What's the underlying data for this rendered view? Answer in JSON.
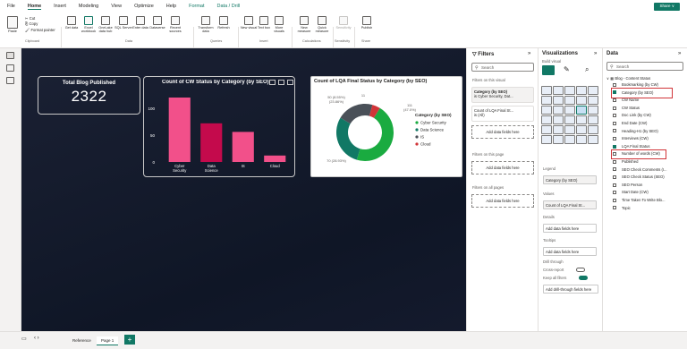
{
  "menu": {
    "items": [
      "File",
      "Home",
      "Insert",
      "Modeling",
      "View",
      "Optimize",
      "Help",
      "Format",
      "Data / Drill"
    ],
    "share": "Share ∨"
  },
  "ribbon": {
    "clip": [
      "Cut",
      "Copy",
      "Format painter"
    ],
    "paste": "Paste",
    "buttons": [
      "Get data",
      "Excel workbook",
      "OneLake data hub",
      "SQL Server",
      "Enter data",
      "Dataverse",
      "Recent sources",
      "Transform data",
      "Refresh",
      "New visual",
      "Text box",
      "More visuals",
      "New measure",
      "Quick measure",
      "Sensitivity",
      "Publish"
    ],
    "groups": [
      "Clipboard",
      "Data",
      "Queries",
      "Insert",
      "Calculations",
      "Sensitivity",
      "Share"
    ]
  },
  "card": {
    "title": "Total Blog Published",
    "value": "2322"
  },
  "bar_chart_title": "Count of CW Status by Category (by SEO)",
  "donut_chart_title": "Count of LQA Final Status by Category (by SEO)",
  "chart_data": [
    {
      "type": "bar",
      "title": "Count of CW Status by Category (by SEO)",
      "categories": [
        "Cyber Security",
        "Data Science",
        "IS",
        "Cloud"
      ],
      "values": [
        120,
        72,
        56,
        12
      ],
      "yticks": [
        "100",
        "50",
        "0"
      ],
      "ylim": [
        0,
        130
      ],
      "color": "#f2508a"
    },
    {
      "type": "pie",
      "title": "Count of LQA Final Status by Category (by SEO)",
      "legend_title": "Category (by SEO)",
      "slices": [
        {
          "name": "Cyber Security",
          "value": 111,
          "label": "111\n(47.0%)",
          "color": "#1aab40"
        },
        {
          "name": "Data Science",
          "value": 70,
          "label": "70 (28.93%)",
          "color": "#117865"
        },
        {
          "name": "IS",
          "value": 50,
          "label": "50 (8.55%)\n(23.86%)",
          "color": "#4a5058"
        },
        {
          "name": "Cloud",
          "value": 11,
          "label": "11",
          "color": "#d13438"
        }
      ]
    }
  ],
  "filters": {
    "title": "Filters",
    "search": "Search",
    "on_visual": "Filters on this visual",
    "card1_title": "Category (by SEO)",
    "card1_value": "is Cyber Security, Dat...",
    "card2_title": "Count of LQA Final St...",
    "card2_value": "is (All)",
    "add": "Add data fields here",
    "on_page": "Filters on this page",
    "on_all": "Filters on all pages"
  },
  "viz": {
    "title": "Visualizations",
    "build": "Build visual",
    "legend": "Legend",
    "legend_field": "Category (by SEO)",
    "values": "Values",
    "values_field": "Count of LQA Final St...",
    "details": "Details",
    "add": "Add data fields here",
    "tooltips": "Tooltips",
    "drill": "Drill through",
    "cross": "Cross-report",
    "keep": "Keep all filters",
    "add_drill": "Add drill-through fields here"
  },
  "data": {
    "title": "Data",
    "search": "Search",
    "table": "Blog - Content Status",
    "fields": [
      "Bookmarking (by CW)",
      "Category (by SEO)",
      "CW Name",
      "CW Status",
      "Doc Link (by CW)",
      "End Date (CW)",
      "Heading-H1 (by SEO)",
      "Interviews (CW)",
      "LQA Final Status",
      "Number of words (CW)",
      "Published",
      "SEO Check Comments (I...",
      "SEO Check Status (SEO)",
      "SEO Person",
      "Start Date (CW)",
      "Time Taken To Write Blo...",
      "Topic"
    ],
    "checked": [
      1,
      8
    ]
  },
  "pages": {
    "tab1": "Reference",
    "tab2": "Page 1",
    "add": "+"
  }
}
